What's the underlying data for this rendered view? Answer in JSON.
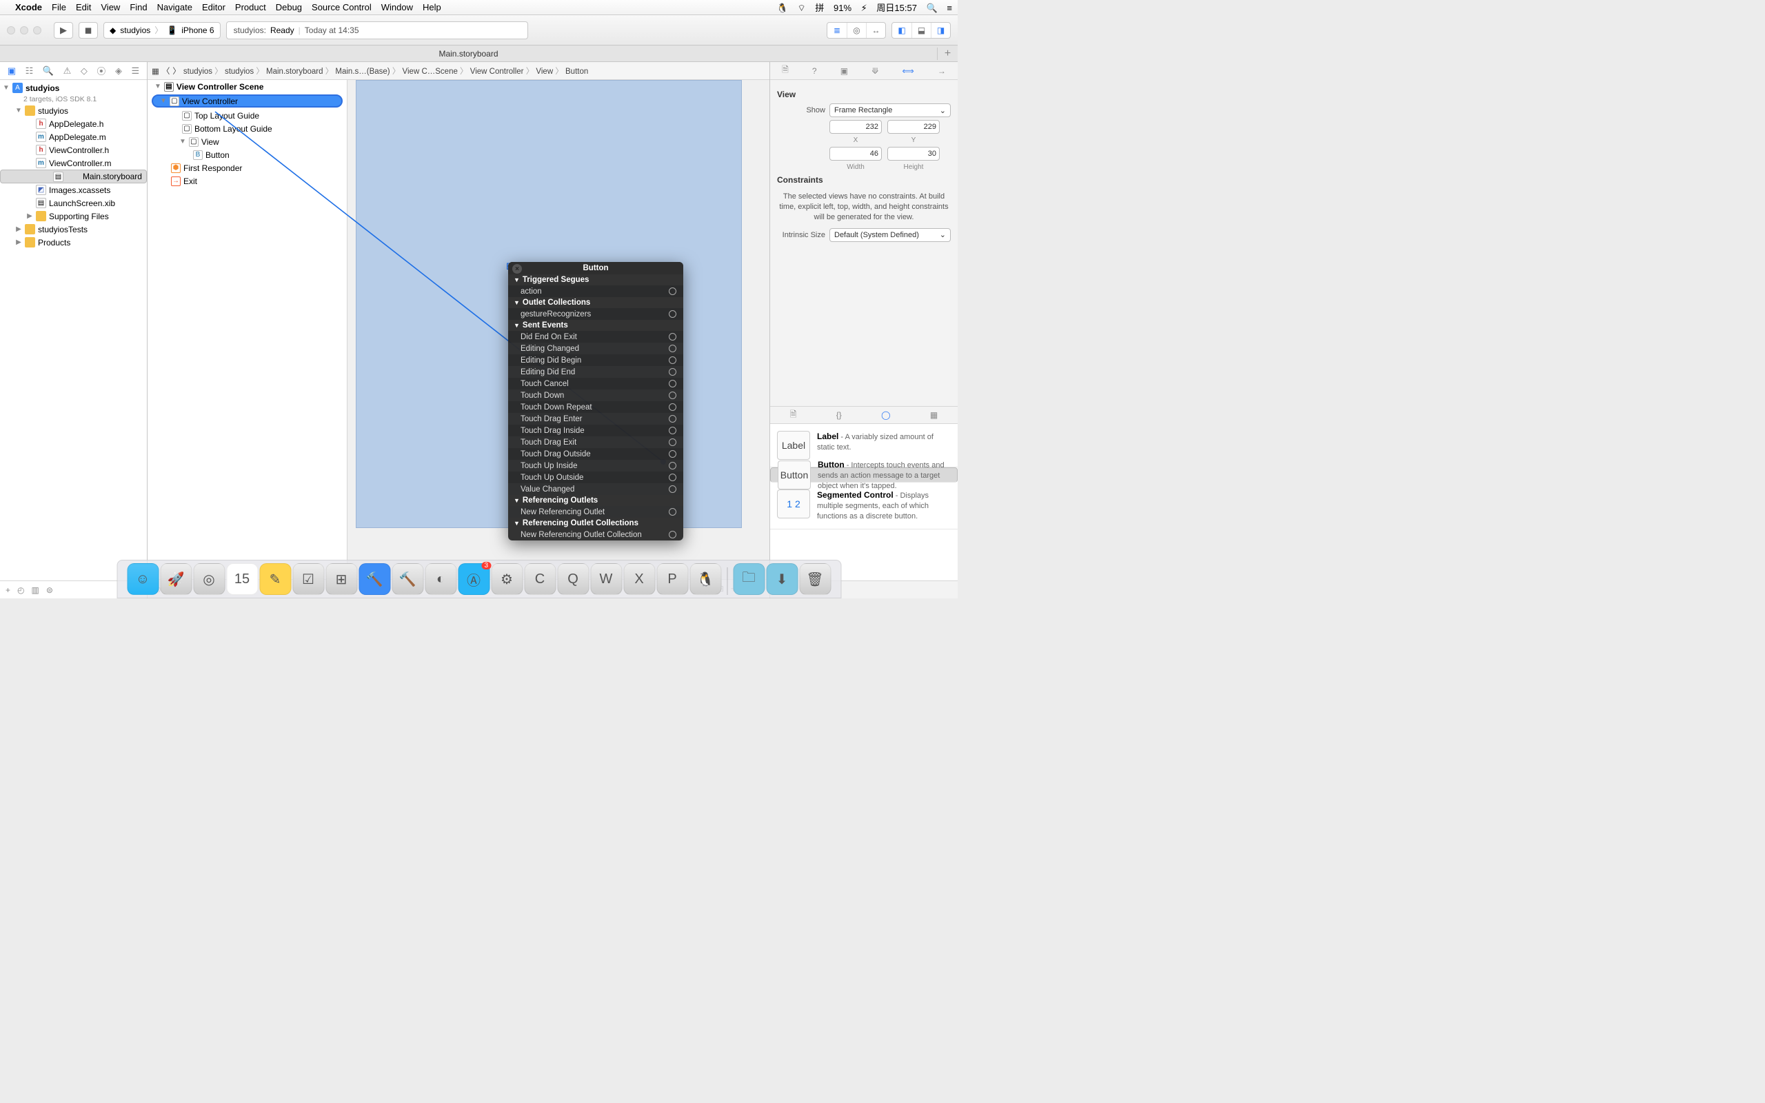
{
  "menubar": {
    "app": "Xcode",
    "items": [
      "File",
      "Edit",
      "View",
      "Find",
      "Navigate",
      "Editor",
      "Product",
      "Debug",
      "Source Control",
      "Window",
      "Help"
    ],
    "battery": "91%",
    "ime": "拼",
    "date": "周日15:57"
  },
  "toolbar": {
    "scheme_app": "studyios",
    "scheme_dest": "iPhone 6",
    "status_app": "studyios:",
    "status_state": "Ready",
    "status_time": "Today at 14:35"
  },
  "tab": {
    "title": "Main.storyboard"
  },
  "navigator": {
    "project": "studyios",
    "project_sub": "2 targets, iOS SDK 8.1",
    "rows": [
      {
        "d": 1,
        "t": "folder",
        "l": "studyios",
        "open": true
      },
      {
        "d": 2,
        "t": "h",
        "l": "AppDelegate.h"
      },
      {
        "d": 2,
        "t": "m",
        "l": "AppDelegate.m"
      },
      {
        "d": 2,
        "t": "h",
        "l": "ViewController.h"
      },
      {
        "d": 2,
        "t": "m",
        "l": "ViewController.m"
      },
      {
        "d": 2,
        "t": "sb",
        "l": "Main.storyboard",
        "sel": true
      },
      {
        "d": 2,
        "t": "img",
        "l": "Images.xcassets"
      },
      {
        "d": 2,
        "t": "sb",
        "l": "LaunchScreen.xib"
      },
      {
        "d": 2,
        "t": "folder",
        "l": "Supporting Files",
        "open": false
      },
      {
        "d": 1,
        "t": "folder",
        "l": "studyiosTests",
        "open": false
      },
      {
        "d": 1,
        "t": "folder",
        "l": "Products",
        "open": false
      }
    ]
  },
  "jumpbar": [
    "studyios",
    "studyios",
    "Main.storyboard",
    "Main.s…(Base)",
    "View C…Scene",
    "View Controller",
    "View",
    "Button"
  ],
  "outline": {
    "scene": "View Controller Scene",
    "rows": [
      {
        "d": 1,
        "l": "View Controller",
        "sel": true,
        "disc": "▼"
      },
      {
        "d": 2,
        "l": "Top Layout Guide"
      },
      {
        "d": 2,
        "l": "Bottom Layout Guide"
      },
      {
        "d": 2,
        "l": "View",
        "disc": "▼"
      },
      {
        "d": 3,
        "l": "Button",
        "ic": "B"
      },
      {
        "d": 1,
        "l": "First Responder",
        "ic": "⬢",
        "c": "#f58c2e"
      },
      {
        "d": 1,
        "l": "Exit",
        "ic": "→",
        "c": "#f55b2e"
      }
    ]
  },
  "inspector": {
    "section_view": "View",
    "show_label": "Show",
    "show_value": "Frame Rectangle",
    "x": "232",
    "y": "229",
    "w": "46",
    "h": "30",
    "axis_x": "X",
    "axis_y": "Y",
    "axis_w": "Width",
    "axis_h": "Height",
    "constraints_title": "Constraints",
    "constraints_msg": "The selected views have no constraints. At build time, explicit left, top, width, and height constraints will be generated for the view.",
    "intrinsic_label": "Intrinsic Size",
    "intrinsic_value": "Default (System Defined)"
  },
  "library": [
    {
      "title": "Label",
      "icon": "Label",
      "desc": " - A variably sized amount of static text."
    },
    {
      "title": "Button",
      "icon": "Button",
      "desc": " - Intercepts touch events and sends an action message to a target object when it's tapped.",
      "sel": true
    },
    {
      "title": "Segmented Control",
      "icon": "1 2",
      "desc": " - Displays multiple segments, each of which functions as a discrete button."
    }
  ],
  "popup": {
    "title": "Button",
    "sections": [
      {
        "title": "Triggered Segues",
        "items": [
          "action"
        ]
      },
      {
        "title": "Outlet Collections",
        "items": [
          "gestureRecognizers"
        ]
      },
      {
        "title": "Sent Events",
        "items": [
          "Did End On Exit",
          "Editing Changed",
          "Editing Did Begin",
          "Editing Did End",
          "Touch Cancel",
          "Touch Down",
          "Touch Down Repeat",
          "Touch Drag Enter",
          "Touch Drag Inside",
          "Touch Drag Exit",
          "Touch Drag Outside",
          "Touch Up Inside",
          "Touch Up Outside",
          "Value Changed"
        ]
      },
      {
        "title": "Referencing Outlets",
        "items": [
          "New Referencing Outlet"
        ]
      },
      {
        "title": "Referencing Outlet Collections",
        "items": [
          "New Referencing Outlet Collection"
        ]
      }
    ]
  },
  "canvas": {
    "button_text_prefix": "B"
  }
}
